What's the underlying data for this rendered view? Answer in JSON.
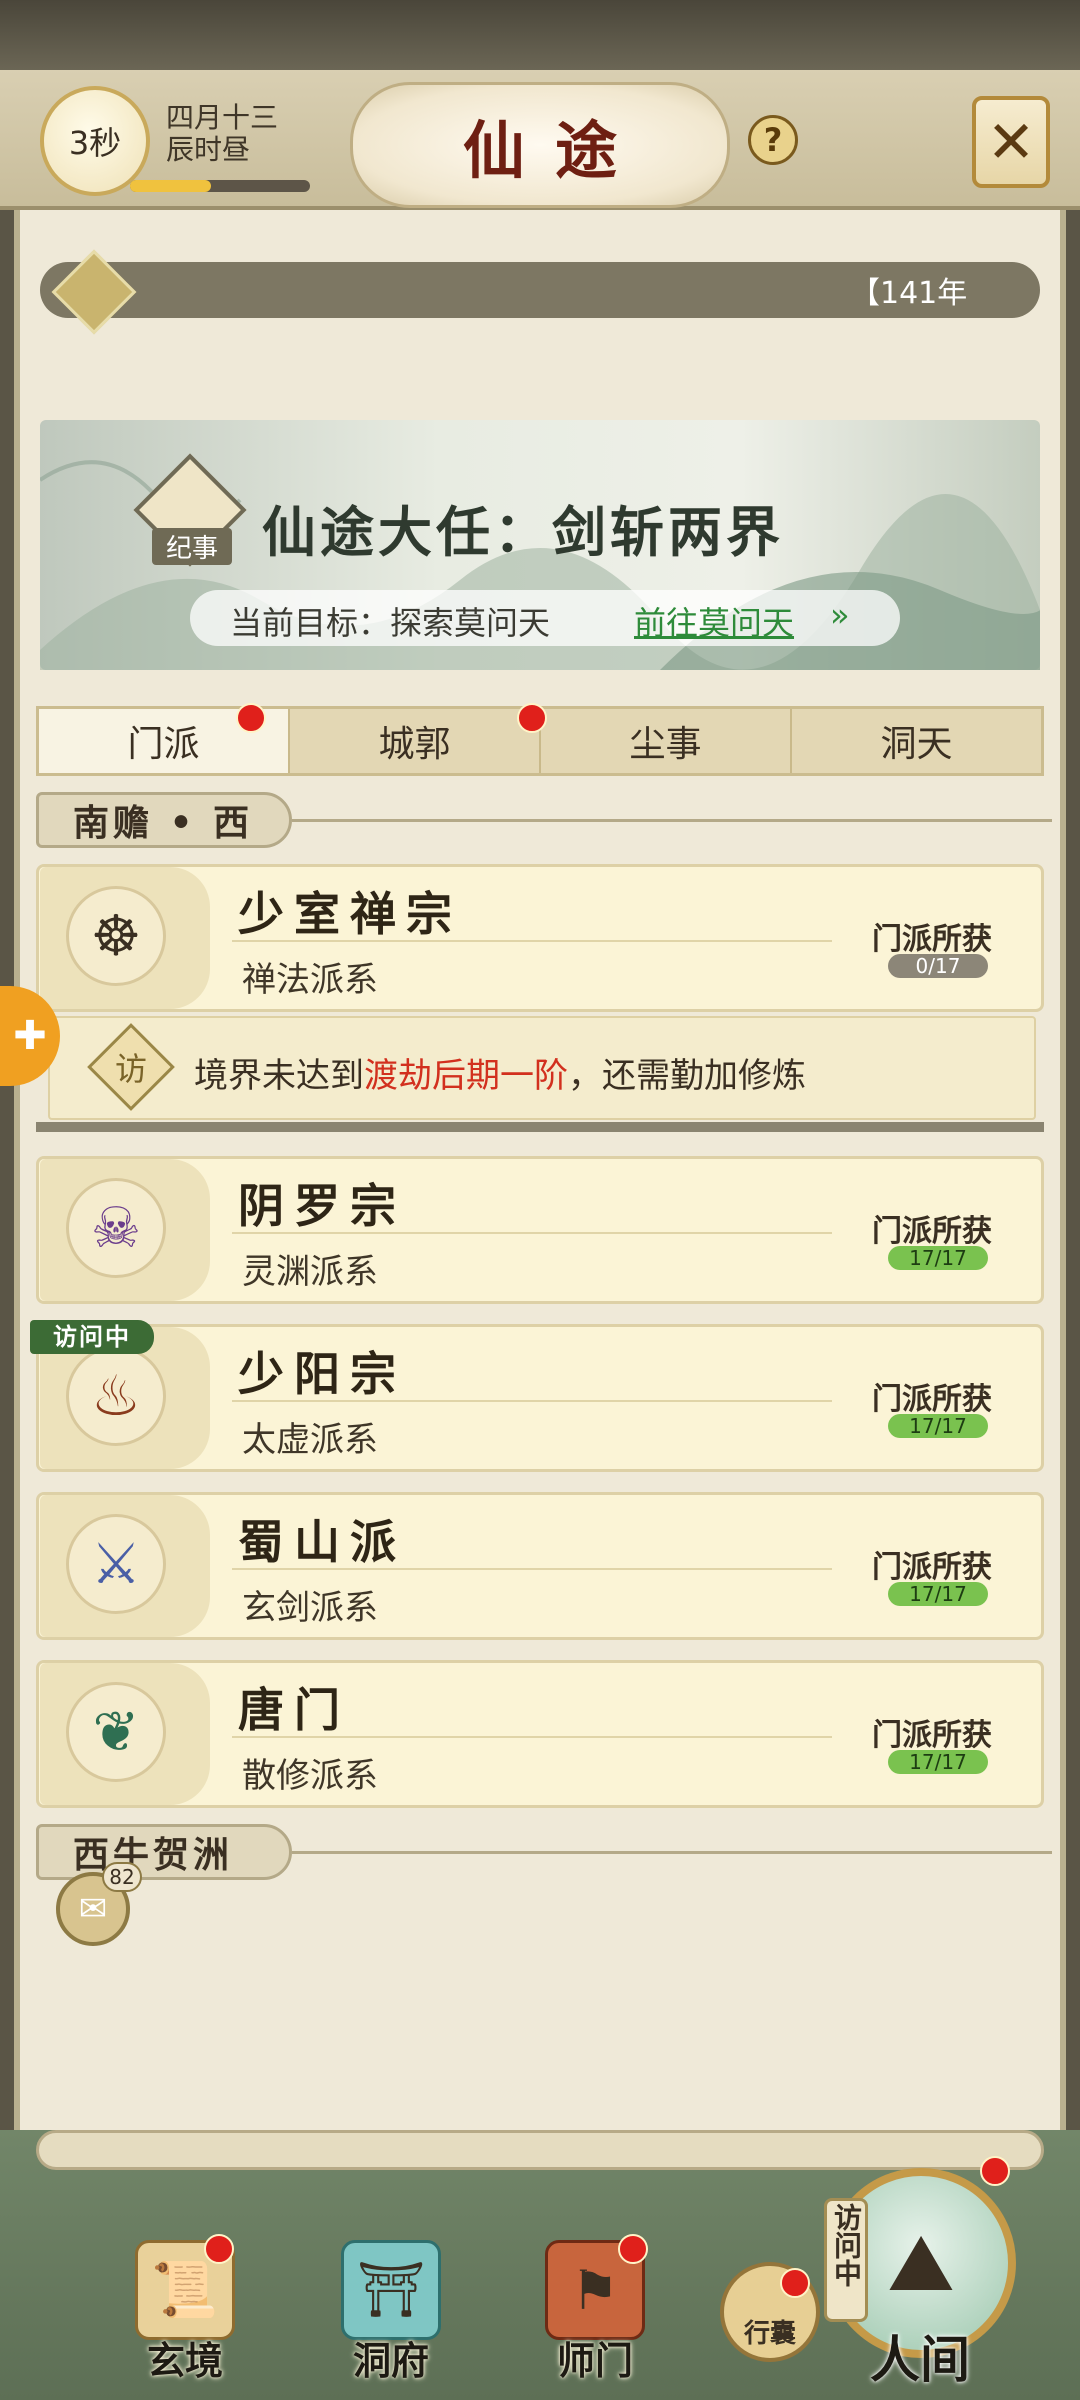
{
  "header": {
    "timer": "3秒",
    "date_line1": "四月十三",
    "date_line2": "辰时昼",
    "progress": 0.45,
    "title": "仙途",
    "help": "?",
    "close": "✕"
  },
  "year": {
    "text": "【141年"
  },
  "quest": {
    "badge": "纪事",
    "title": "仙途大任：剑斩两界",
    "goal_label": "当前目标：探索莫问天",
    "goal_link": "前往莫问天",
    "goal_arrow": "»"
  },
  "tabs": [
    {
      "label": "门派",
      "dot": true,
      "active": true
    },
    {
      "label": "城郭",
      "dot": true,
      "active": false
    },
    {
      "label": "尘事",
      "dot": false,
      "active": false
    },
    {
      "label": "洞天",
      "dot": false,
      "active": false
    }
  ],
  "regions": {
    "r1": "南赡 • 西",
    "r2": "西牛贺洲"
  },
  "sects": [
    {
      "name": "少室禅宗",
      "school": "禅法派系",
      "gain_label": "门派所获",
      "gain": "0/17",
      "complete": false,
      "icon": "lotus-icon"
    },
    {
      "name": "阴罗宗",
      "school": "灵渊派系",
      "gain_label": "门派所获",
      "gain": "17/17",
      "complete": true,
      "icon": "demon-mask-icon"
    },
    {
      "name": "少阳宗",
      "school": "太虚派系",
      "gain_label": "门派所获",
      "gain": "17/17",
      "complete": true,
      "icon": "cauldron-icon"
    },
    {
      "name": "蜀山派",
      "school": "玄剑派系",
      "gain_label": "门派所获",
      "gain": "17/17",
      "complete": true,
      "icon": "sword-icon"
    },
    {
      "name": "唐门",
      "school": "散修派系",
      "gain_label": "门派所获",
      "gain": "17/17",
      "complete": true,
      "icon": "fan-icon"
    }
  ],
  "locked": {
    "badge": "访",
    "pre": "境界未达到",
    "highlight": "渡劫后期一阶",
    "post": "，还需勤加修炼"
  },
  "visiting_tag": "访问中",
  "chat": {
    "count": "82"
  },
  "nav": {
    "items": [
      {
        "label": "玄境",
        "dot": true
      },
      {
        "label": "洞府",
        "dot": false
      },
      {
        "label": "师门",
        "dot": true
      }
    ],
    "pouch": "行囊",
    "visit_vertical": "访问中",
    "world": "人间"
  },
  "colors": {
    "accent_red": "#e0201b",
    "link_green": "#2e8b3a",
    "complete_green": "#7ac24f",
    "title_red": "#6e1f12"
  }
}
